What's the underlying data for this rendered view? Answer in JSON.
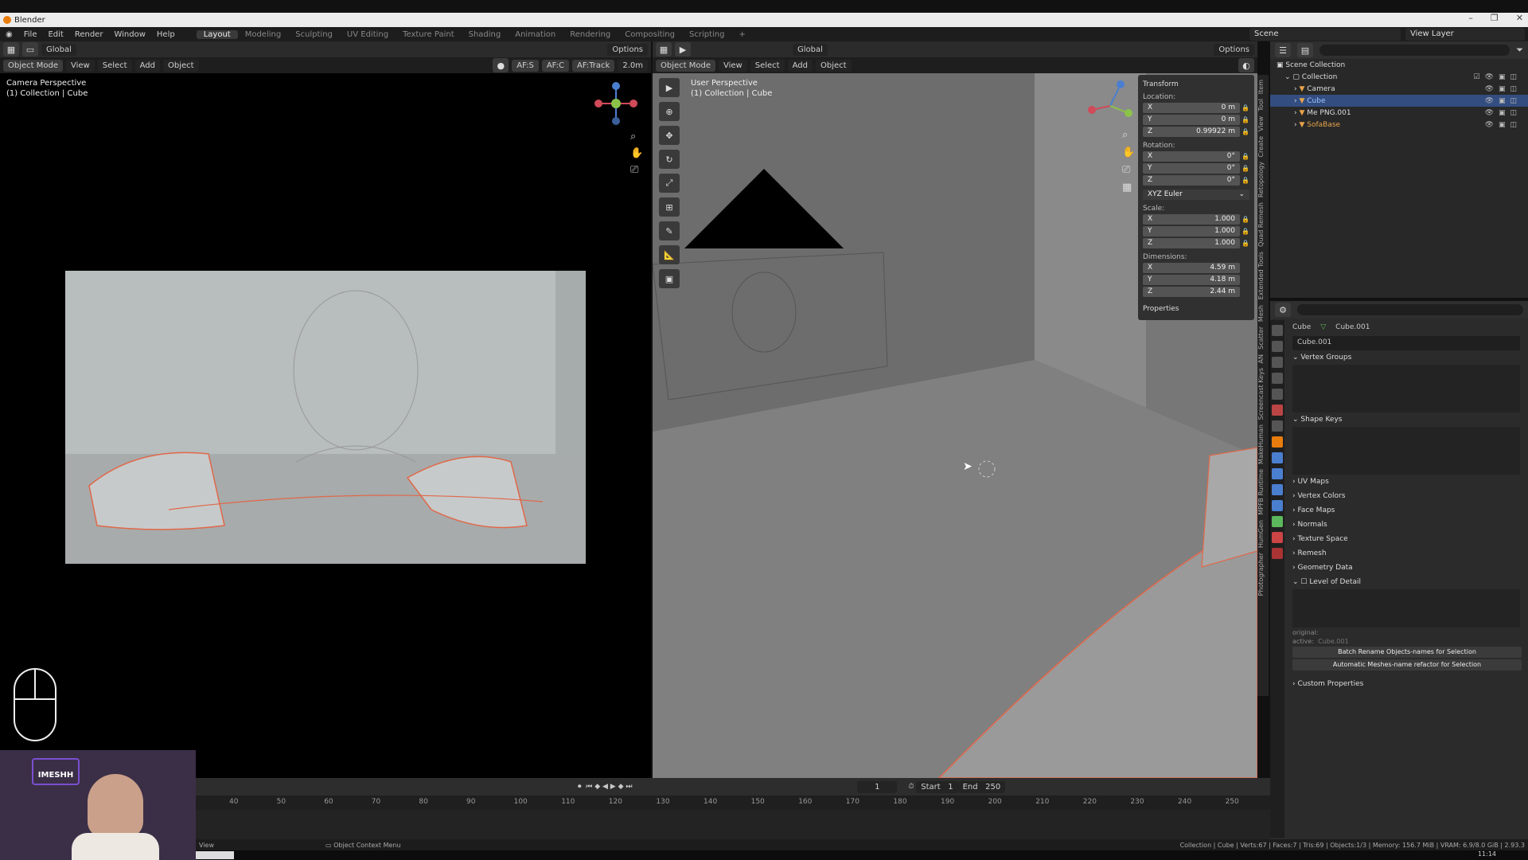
{
  "app": {
    "title": "Blender"
  },
  "menu": [
    "File",
    "Edit",
    "Render",
    "Window",
    "Help"
  ],
  "workspaces": [
    "Layout",
    "Modeling",
    "Sculpting",
    "UV Editing",
    "Texture Paint",
    "Shading",
    "Animation",
    "Rendering",
    "Compositing",
    "Scripting"
  ],
  "scene": {
    "label": "Scene",
    "view_layer": "View Layer"
  },
  "left_viewport": {
    "mode": "Object Mode",
    "menus": [
      "View",
      "Select",
      "Add",
      "Object"
    ],
    "orientation": "Global",
    "options": "Options",
    "af_s": "AF:S",
    "af_c": "AF:C",
    "af_track": "AF:Track",
    "distance": "2.0m",
    "title": "Camera Perspective",
    "subtitle": "(1) Collection | Cube"
  },
  "right_viewport": {
    "mode": "Object Mode",
    "menus": [
      "View",
      "Select",
      "Add",
      "Object"
    ],
    "orientation": "Global",
    "options": "Options",
    "title": "User Perspective",
    "subtitle": "(1) Collection | Cube"
  },
  "transform": {
    "header": "Transform",
    "location_label": "Location:",
    "location": [
      {
        "axis": "X",
        "value": "0 m"
      },
      {
        "axis": "Y",
        "value": "0 m"
      },
      {
        "axis": "Z",
        "value": "0.99922 m"
      }
    ],
    "rotation_label": "Rotation:",
    "rotation": [
      {
        "axis": "X",
        "value": "0°"
      },
      {
        "axis": "Y",
        "value": "0°"
      },
      {
        "axis": "Z",
        "value": "0°"
      }
    ],
    "rotation_mode": "XYZ Euler",
    "scale_label": "Scale:",
    "scale": [
      {
        "axis": "X",
        "value": "1.000"
      },
      {
        "axis": "Y",
        "value": "1.000"
      },
      {
        "axis": "Z",
        "value": "1.000"
      }
    ],
    "dimensions_label": "Dimensions:",
    "dimensions": [
      {
        "axis": "X",
        "value": "4.59 m"
      },
      {
        "axis": "Y",
        "value": "4.18 m"
      },
      {
        "axis": "Z",
        "value": "2.44 m"
      }
    ],
    "properties": "Properties"
  },
  "sidebar_tabs": [
    "Item",
    "Tool",
    "View",
    "Create",
    "Retopology",
    "Quad Remesh",
    "Extended Tools",
    "Mesh",
    "Scatter",
    "AN",
    "Screencast Keys",
    "MakeHuman",
    "MPFB Runtime",
    "HumGen",
    "Photographer"
  ],
  "outliner": {
    "root": "Scene Collection",
    "collection": "Collection",
    "items": [
      {
        "name": "Camera",
        "selected": false
      },
      {
        "name": "Cube",
        "selected": true
      },
      {
        "name": "Me PNG.001",
        "selected": false
      },
      {
        "name": "SofaBase",
        "selected": false
      }
    ]
  },
  "properties": {
    "object": "Cube",
    "mesh": "Cube.001",
    "datablock": "Cube.001",
    "sections": [
      "Vertex Groups",
      "Shape Keys",
      "UV Maps",
      "Vertex Colors",
      "Face Maps",
      "Normals",
      "Texture Space",
      "Remesh",
      "Geometry Data",
      "Level of Detail"
    ],
    "lod_original": "original:",
    "lod_active": "active:",
    "lod_active_value": "Cube.001",
    "batch_button": "Batch Rename Objects-names for Selection",
    "auto_button": "Automatic Meshes-name refactor for Selection",
    "custom": "Custom Properties"
  },
  "timeline": {
    "current": "1",
    "start_label": "Start",
    "start": "1",
    "end_label": "End",
    "end": "250",
    "ticks": [
      "40",
      "50",
      "60",
      "70",
      "80",
      "90",
      "100",
      "110",
      "120",
      "130",
      "140",
      "150",
      "160",
      "170",
      "180",
      "190",
      "200",
      "210",
      "220",
      "230",
      "240",
      "250"
    ]
  },
  "status": {
    "left": "View",
    "context": "Object Context Menu",
    "right": "Collection | Cube | Verts:67 | Faces:7 | Tris:69 | Objects:1/3 | Memory: 156.7 MiB | VRAM: 6.9/8.0 GiB | 2.93.3"
  },
  "clock": "11:14",
  "webcam": {
    "logo": "IMESHH"
  }
}
